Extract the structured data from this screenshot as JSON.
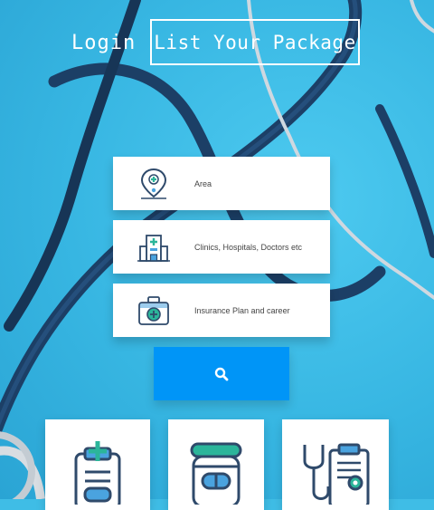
{
  "nav": {
    "login_label": "Login",
    "list_package_label": "List Your Package"
  },
  "search": {
    "rows": [
      {
        "label": "Area",
        "icon": "location-pin-icon"
      },
      {
        "label": "Clinics, Hospitals, Doctors etc",
        "icon": "hospital-icon"
      },
      {
        "label": "Insurance Plan and career",
        "icon": "medical-kit-icon"
      }
    ],
    "button_icon": "search-icon"
  },
  "categories": [
    {
      "icon": "clipboard-cross-icon"
    },
    {
      "icon": "medicine-jar-icon"
    },
    {
      "icon": "stethoscope-report-icon"
    }
  ],
  "colors": {
    "background": "#3fbde6",
    "accent": "#0095f7",
    "icon_dark": "#2f4a6b",
    "icon_teal": "#2bb59a",
    "icon_blue": "#4aa3df"
  }
}
